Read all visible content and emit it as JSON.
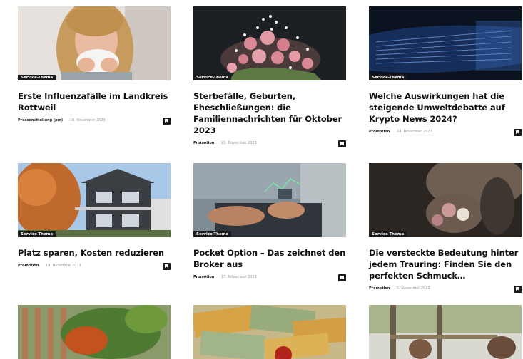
{
  "articles": [
    {
      "badge": "Service-Thema",
      "title": "Erste Influenzafälle im Landkreis Rottweil",
      "author": "Pressemitteilung (pm)",
      "date": "10. November 2023",
      "image_icon": "woman-sneezing-image"
    },
    {
      "badge": "Service-Thema",
      "title": "Sterbefälle, Geburten, Eheschließungen: die Familiennachrichten für Oktober 2023",
      "author": "Promotion",
      "date": "25. November 2023",
      "image_icon": "flower-bouquet-image"
    },
    {
      "badge": "Service-Thema",
      "title": "Welche Auswirkungen hat die steigende Umweltdebatte auf Krypto News 2024?",
      "author": "Promotion",
      "date": "24. November 2023",
      "image_icon": "digital-data-image"
    },
    {
      "badge": "Service-Thema",
      "title": "Platz sparen, Kosten reduzieren",
      "author": "Promotion",
      "date": "19. November 2023",
      "image_icon": "modern-house-image"
    },
    {
      "badge": "Service-Thema",
      "title": "Pocket Option – Das zeichnet den Broker aus",
      "author": "Promotion",
      "date": "17. November 2023",
      "image_icon": "trading-laptop-image"
    },
    {
      "badge": "Service-Thema",
      "title": "Die versteckte Bedeutung hinter jedem Trauring: Finden Sie den perfekten Schmuck…",
      "author": "Promotion",
      "date": "5. November 2023",
      "image_icon": "wedding-bouquet-image"
    },
    {
      "image_icon": "garden-fence-image"
    },
    {
      "image_icon": "money-banknotes-image"
    },
    {
      "image_icon": "people-outdoor-image"
    }
  ],
  "colors": {
    "badge_bg": "#1b1b1b",
    "title": "#111111",
    "meta": "#999999"
  }
}
